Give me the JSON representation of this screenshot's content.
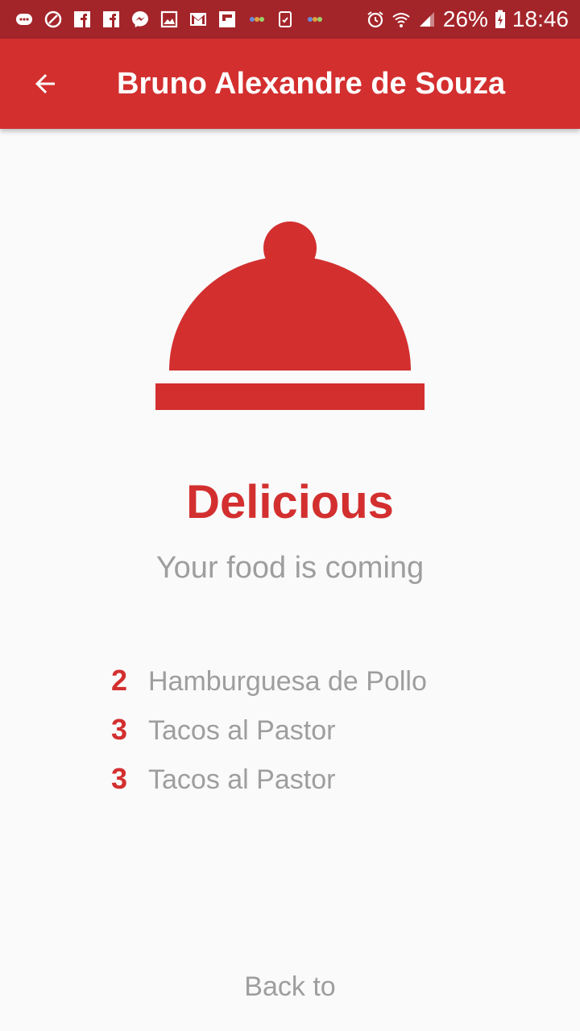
{
  "status_bar": {
    "notification_icons": [
      "messages-icon",
      "link-icon",
      "facebook-icon",
      "facebook-icon",
      "messenger-icon",
      "gallery-icon",
      "gmail-icon",
      "flipboard-icon",
      "app-icon",
      "clipboard-icon",
      "app-icon"
    ],
    "battery": "26%",
    "time": "18:46"
  },
  "app_bar": {
    "back_icon": "arrow-back-icon",
    "title": "Bruno Alexandre de Souza",
    "color": "#d32f2f"
  },
  "hero": {
    "icon": "food-cloche-icon",
    "title": "Delicious",
    "subtitle": "Your food is coming"
  },
  "order": {
    "items": [
      {
        "qty": "2",
        "name": "Hamburguesa de Pollo"
      },
      {
        "qty": "3",
        "name": "Tacos al Pastor"
      },
      {
        "qty": "3",
        "name": "Tacos al Pastor"
      }
    ]
  },
  "footer": {
    "back_label": "Back to"
  }
}
